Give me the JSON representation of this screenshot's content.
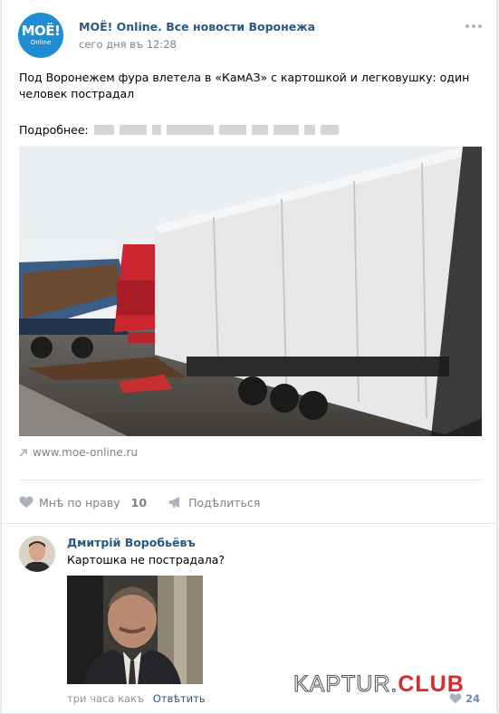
{
  "post": {
    "group_name": "МОЁ! Online. Все новости Воронежа",
    "time": "сего дня въ 12:28",
    "avatar_logo": "МОЁ!",
    "avatar_sub": "Online",
    "text": "Под Воронежем фура влетела в «КамАЗ» с картошкой и легковушку: один человек пострадал",
    "more_label": "Подробнее:",
    "link_domain": "www.moe-online.ru",
    "like_label": "Мнѣ по нраву",
    "like_count": "10",
    "share_label": "Подѣлиться"
  },
  "comment": {
    "author": "Дмитрій Воробьёвъ",
    "text": "Картошка не пострадала?",
    "time": "три часа какъ",
    "reply_label": "Отвѣтить",
    "like_count": "24"
  },
  "watermark": {
    "main": "KAPTUR.",
    "accent": "CLUB"
  },
  "icons": {
    "more": "more-dots-icon",
    "link": "link-arrow-icon",
    "like": "heart-icon",
    "share": "megaphone-icon",
    "comment_like": "heart-icon"
  },
  "colors": {
    "link_blue": "#2a5885",
    "secondary_gray": "#828282",
    "accent_red": "#d92b2b"
  }
}
